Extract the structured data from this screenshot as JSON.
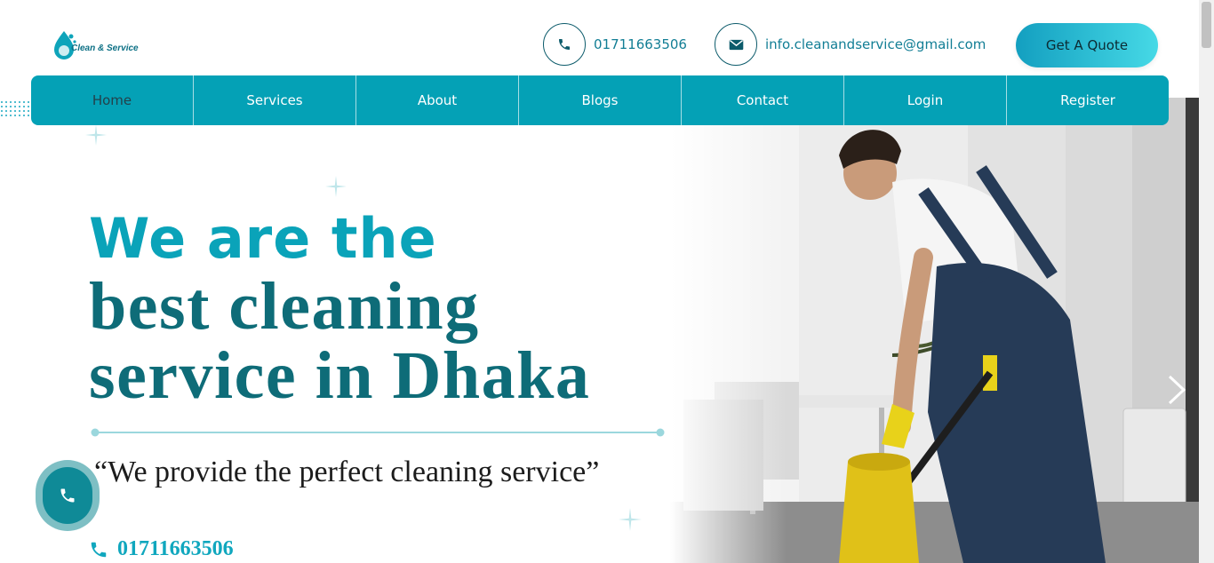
{
  "header": {
    "logo_text": "Clean & Service",
    "phone": "01711663506",
    "email": "info.cleanandservice@gmail.com",
    "quote_button": "Get A Quote"
  },
  "nav": {
    "items": [
      {
        "label": "Home",
        "active": true
      },
      {
        "label": "Services"
      },
      {
        "label": "About"
      },
      {
        "label": "Blogs"
      },
      {
        "label": "Contact"
      },
      {
        "label": "Login"
      },
      {
        "label": "Register"
      }
    ]
  },
  "hero": {
    "line1": "We are the",
    "line2": "best cleaning",
    "line3": "service in Dhaka",
    "tagline": "“We provide the perfect cleaning service”",
    "phone": "01711663506"
  },
  "colors": {
    "brand": "#04a1b6",
    "heading_dark": "#0e6c78",
    "heading_light": "#0aa3b9"
  },
  "icons": [
    "phone-icon",
    "envelope-icon",
    "chevron-right-icon"
  ]
}
